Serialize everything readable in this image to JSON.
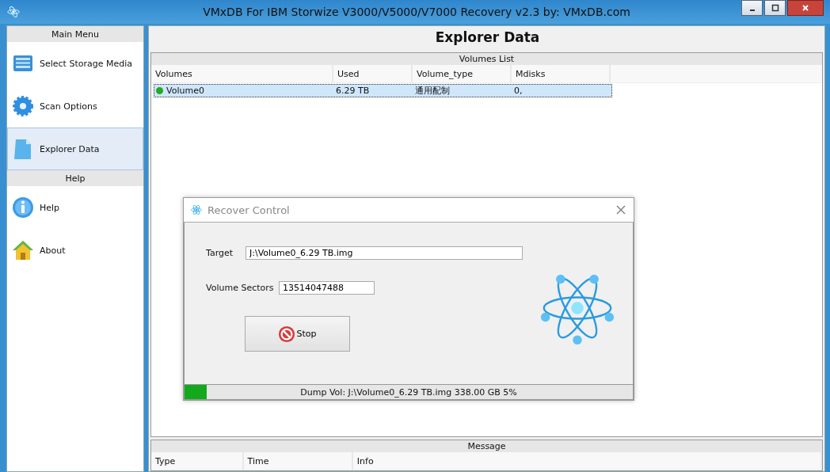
{
  "window": {
    "title": "VMxDB For IBM Storwize V3000/V5000/V7000 Recovery v2.3 by: VMxDB.com"
  },
  "sidebar": [
    {
      "kind": "section",
      "label": "Main Menu"
    },
    {
      "kind": "item",
      "label": "Select Storage Media",
      "selected": false
    },
    {
      "kind": "item",
      "label": "Scan Options",
      "selected": false
    },
    {
      "kind": "item",
      "label": "Explorer Data",
      "selected": true
    },
    {
      "kind": "section",
      "label": "Help"
    },
    {
      "kind": "item",
      "label": "Help",
      "selected": false
    },
    {
      "kind": "item",
      "label": "About",
      "selected": false
    }
  ],
  "page_title": "Explorer Data",
  "volumes": {
    "title": "Volumes List",
    "columns": [
      "Volumes",
      "Used",
      "Volume_type",
      "Mdisks"
    ],
    "rows": [
      {
        "cells": [
          "Volume0",
          "6.29 TB",
          "通用配制",
          "0,"
        ],
        "selected": true,
        "color": "#22aa22"
      }
    ]
  },
  "dialog": {
    "title": "Recover Control",
    "target_label": "Target",
    "target": "J:\\Volume0_6.29 TB.img",
    "sectors_label": "Volume Sectors",
    "sectors": "13514047488",
    "button": "Stop",
    "progress": {
      "level": 0.05,
      "text": "Dump Vol: J:\\Volume0_6.29 TB.img  338.00 GB  5%"
    }
  },
  "messages": {
    "title": "Message",
    "columns": [
      "Type",
      "Time",
      "Info"
    ]
  }
}
